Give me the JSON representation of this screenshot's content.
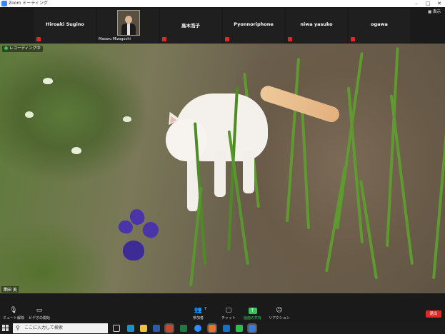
{
  "window": {
    "title": "Zoom ミーティング",
    "minimize_icon": "minimize-icon",
    "maximize_icon": "maximize-icon",
    "close_icon": "close-icon"
  },
  "participants": [
    {
      "name": "Hiroaki Sugino",
      "muted": true
    },
    {
      "name": "Masaru Mizoguchi",
      "video": true
    },
    {
      "name": "高木浩子",
      "muted": true
    },
    {
      "name": "Pyonnoriphone",
      "muted": true
    },
    {
      "name": "niwa yasuko",
      "muted": true
    },
    {
      "name": "ogawa",
      "muted": true
    }
  ],
  "view_button": {
    "label": "表示",
    "icon": "grid-icon"
  },
  "main_video": {
    "recording_label": "レコーディング中",
    "speaker_name": "澤田 美"
  },
  "controls": {
    "mute": {
      "label": "ミュート解除",
      "icon": "microphone-muted-icon"
    },
    "video": {
      "label": "ビデオの開始",
      "icon": "video-off-icon"
    },
    "participants": {
      "label": "参加者",
      "count": "7",
      "icon": "participants-icon"
    },
    "chat": {
      "label": "チャット",
      "icon": "chat-icon"
    },
    "share": {
      "label": "画面の共有",
      "icon": "share-screen-icon"
    },
    "reactions": {
      "label": "リアクション",
      "icon": "reaction-icon"
    },
    "end": {
      "label": "退出"
    }
  },
  "taskbar": {
    "search_placeholder": "ここに入力して検索",
    "icons": [
      "task-view-icon",
      "edge-icon",
      "explorer-icon",
      "word-icon",
      "excel-icon",
      "powerpoint-icon",
      "zoom-icon",
      "firefox-icon",
      "outlook-icon",
      "line-icon",
      "mail-icon",
      "zoom-app-icon"
    ]
  },
  "colors": {
    "end_button": "#e02828",
    "share_green": "#3cc05a",
    "mute_red": "#e02828"
  }
}
